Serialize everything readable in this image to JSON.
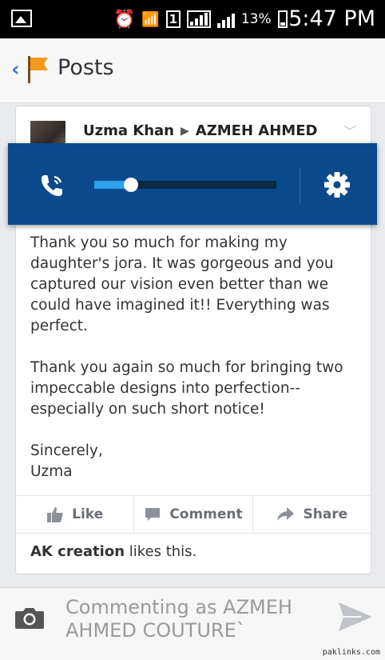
{
  "status_bar": {
    "battery": "13%",
    "time": "5:47 PM",
    "sim_slot": "1"
  },
  "app_bar": {
    "title": "Posts"
  },
  "post": {
    "author": "Uzma Khan",
    "target": "AZMEH AHMED",
    "paragraphs": [
      "Thank you so much for making my daughter's jora. It was gorgeous and you captured our vision even better than we could have imagined it!! Everything was perfect.",
      "Thank you again so much for bringing two impeccable designs into perfection-- especially on such short notice!",
      "Sincerely,\nUzma"
    ],
    "actions": {
      "like": "Like",
      "comment": "Comment",
      "share": "Share"
    },
    "likes": {
      "name": "AK creation",
      "suffix": " likes this."
    }
  },
  "volume_panel": {
    "level": 0.2,
    "colors": {
      "panel": "#0a4a8c",
      "fill": "#2ea0ec",
      "track": "#0b2845"
    }
  },
  "composer": {
    "placeholder": "Commenting as AZMEH AHMED COUTURE`"
  },
  "watermark": "paklinks.com"
}
